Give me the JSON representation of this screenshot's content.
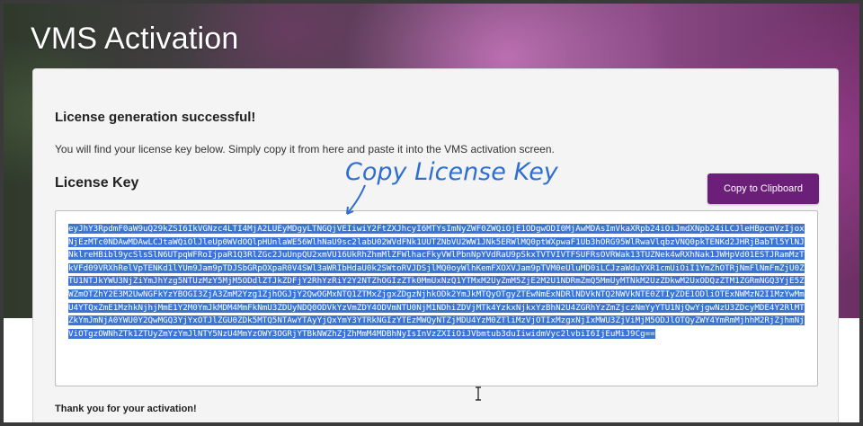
{
  "page": {
    "title": "VMS Activation"
  },
  "card": {
    "success_heading": "License generation successful!",
    "instructions": "You will find your license key below. Simply copy it from here and paste it into the VMS activation screen.",
    "license_heading": "License Key",
    "copy_button_label": "Copy to Clipboard",
    "license_key_lines": [
      "eyJhY3RpdmF0aW9uQ29kZSI6IkVGNzc4LTI4MjA2LUEyMDgyLTNGQjVEIiwiY2FtZXJhcyI6MTYsImNyZWF0ZWQiOjE1ODgwODI0MjAwMDAsImVkaXRpb24iOiJmdXNpb24iLCJl",
      "eHBpcmVzIjoxNjEzMTc0NDAwMDAwLCJtaWQiOlJleUp0WVdOQlpHUnlaWE56WlhNaU9sc2labU02WVdFNk1UUTZNbVU2WW1JNk5ERWlMQ0ptWXpwaF1Ub3hORG95WlRwaVlqbzVN",
      "Q0pkTENKd2JHRjBabTl5YlNJNklreHBibl9ycSlsSlN6UTpqWFRoIjpaR1Q3RlZGc2JuUnpQU2xmVU16UkRhZhmMlZFWlhacFkyVWlPbnNpYVdRaU9pSkxTVTVIVTFS",
      "UFRsOVRWak13TUZNek4wRXhNak1JWHpVd01ESTJRamMzTkVFd09VRXhRelVpTENKd1lYUm9Jam9pTDJSbGRpOXpaR0V4SWl3aWRIbHdaU0k2SWtoRVJDSjlMQ0oyWlhKemFXOXVJ",
      "am9pTVM0eUluMD0iLCJzaWduYXR1cmUiOiI1YmZhOTRjNmFlNmFmZjU0ZTU1NTJkYWU3NjZiYmJhYzg5NTUzMzY5MjM5ODdlZTJkZDFjY2RhYzRiY2Y2NTZhOGIzZTk0MmUxNzQ1",
      "YTMxM2UyZmM5ZjE2M2U1NDRmZmQ5MmUyMTNkM2UzZDkwM2UxODQzZTM1ZGRmNGQ3YjE5ZWZmOTZhY2E3M2UwNGFkYzYBOGI3ZjA3ZmM2Yzg1ZjhOGJjY2QwOGMxNTQ1ZTMxZjgx",
      "ZDgzNjhkODk2YmJkMTQyOTgyZTEwNmExNDRlNDVkNTQ2NWVkNTE0ZTIyZDE1ODliOTExNWMzN2I1MzYwMmU4YTQxZmE1MzhkNjhjMmE1Y2M0YmJkMDM4MmFkNmU3ZDUyNDQ0ODVk",
      "YzVmZDY4ODVmNTU0NjM1NDhiZDVjMTk4YzkxNjkxYzBhN2U4ZGRhYzZmZjczNmYyYTU1NjQwYjgwNzU3ZDcyMDE4Y2RlMTZkYmJmNjA0YWU0Y2QwMGQ3YjYxOTJlZGU0ZDk5MTQ5",
      "NTAwYTAyYjQxYmY3YTRkNGIzYTEzMWQyNTZjMDU4YzM0ZTliMzVjOTIxMzgxNjIxMWU3ZjViMjM5ODJlOTQyZWY4YmRmMjhhM2RjZjhmNjViOTgzOWNhZTk1ZTUyZmYzYmJlNTY5",
      "NzU4MmYzOWY3OGRjYTBkNWZhZjZhMmM4MDBhNyIsInVzZXIiOiJVbmtub3duIiwidmVyc2lvbiI6IjEuMiJ9Cg=="
    ],
    "thanks_text": "Thank you for your activation!"
  },
  "annotation": {
    "label": "Copy License Key"
  },
  "colors": {
    "accent_button": "#6b1f78",
    "selection": "#3b76d6",
    "annotation": "#2f6fd1"
  }
}
